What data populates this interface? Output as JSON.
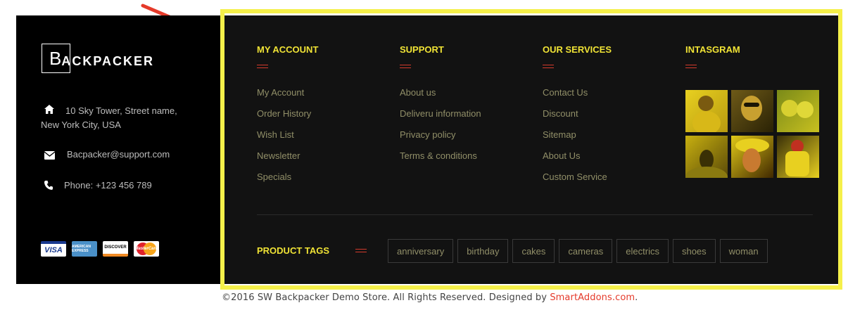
{
  "brand": {
    "logo_first": "B",
    "logo_rest": "ACKPACKER"
  },
  "contact": {
    "address_line1": "10 Sky Tower, Street name,",
    "address_line2": "New York City, USA",
    "email": "Bacpacker@support.com",
    "phone": "Phone: +123 456 789"
  },
  "payments": {
    "visa": "VISA",
    "amex": "AMERICAN EXPRESS",
    "discover": "DISCOVER",
    "mastercard": "MasterCard"
  },
  "columns": [
    {
      "title": "MY ACCOUNT",
      "links": [
        "My Account",
        "Order History",
        "Wish List",
        "Newsletter",
        "Specials"
      ]
    },
    {
      "title": "SUPPORT",
      "links": [
        "About us",
        "Deliveru information",
        "Privacy policy",
        "Terms & conditions"
      ]
    },
    {
      "title": "OUR SERVICES",
      "links": [
        "Contact Us",
        "Discount",
        "Sitemap",
        "About Us",
        "Custom Service"
      ]
    },
    {
      "title": "INTASGRAM"
    }
  ],
  "product_tags": {
    "title": "PRODUCT TAGS",
    "tags": [
      "anniversary",
      "birthday",
      "cakes",
      "cameras",
      "electrics",
      "shoes",
      "woman"
    ]
  },
  "footer": {
    "copyright": "©2016 SW Backpacker Demo Store. All Rights Reserved. Designed by ",
    "designer": "SmartAddons.com",
    "period": "."
  },
  "colors": {
    "accent": "#f0e335",
    "highlight": "#f5f04a",
    "dash": "#d33a2c",
    "link": "#918f68",
    "arrow": "#e53a2a"
  }
}
